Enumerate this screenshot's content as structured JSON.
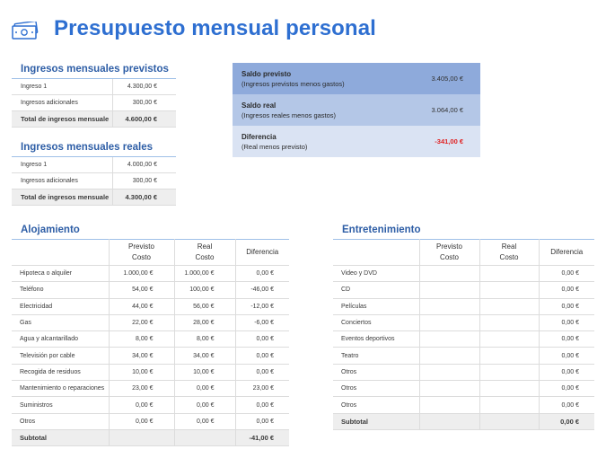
{
  "page": {
    "title": "Presupuesto mensual personal",
    "icon": "money-icon",
    "accent_color": "#2e6fd1"
  },
  "ingresos_previstos": {
    "title": "Ingresos mensuales previstos",
    "rows": [
      {
        "label": "Ingreso 1",
        "value": "4.300,00 €"
      },
      {
        "label": "Ingresos adicionales",
        "value": "300,00 €"
      }
    ],
    "total_label": "Total de ingresos mensuale",
    "total_value": "4.600,00 €"
  },
  "ingresos_reales": {
    "title": "Ingresos mensuales reales",
    "rows": [
      {
        "label": "Ingreso 1",
        "value": "4.000,00 €"
      },
      {
        "label": "Ingresos adicionales",
        "value": "300,00 €"
      }
    ],
    "total_label": "Total de ingresos mensuale",
    "total_value": "4.300,00 €"
  },
  "resumen": {
    "saldo_previsto": {
      "title": "Saldo previsto",
      "subtitle": "(Ingresos previstos menos gastos)",
      "value": "3.405,00 €",
      "bg": "#8eaadb"
    },
    "saldo_real": {
      "title": "Saldo real",
      "subtitle": "(Ingresos reales menos gastos)",
      "value": "3.064,00 €",
      "bg": "#b4c7e7"
    },
    "diferencia": {
      "title": "Diferencia",
      "subtitle": "(Real menos previsto)",
      "value": "-341,00 €",
      "bg": "#dae3f3",
      "value_color": "#e02020"
    }
  },
  "alojamiento": {
    "title": "Alojamiento",
    "headers": {
      "previsto": "Previsto",
      "real": "Real",
      "costo": "Costo",
      "diferencia": "Diferencia"
    },
    "rows": [
      {
        "label": "Hipoteca o alquiler",
        "previsto": "1.000,00 €",
        "real": "1.000,00 €",
        "diferencia": "0,00 €"
      },
      {
        "label": "Teléfono",
        "previsto": "54,00 €",
        "real": "100,00 €",
        "diferencia": "-46,00 €"
      },
      {
        "label": "Electricidad",
        "previsto": "44,00 €",
        "real": "56,00 €",
        "diferencia": "-12,00 €"
      },
      {
        "label": "Gas",
        "previsto": "22,00 €",
        "real": "28,00 €",
        "diferencia": "-6,00 €"
      },
      {
        "label": "Agua y alcantarillado",
        "previsto": "8,00 €",
        "real": "8,00 €",
        "diferencia": "0,00 €"
      },
      {
        "label": "Televisión por cable",
        "previsto": "34,00 €",
        "real": "34,00 €",
        "diferencia": "0,00 €"
      },
      {
        "label": "Recogida de residuos",
        "previsto": "10,00 €",
        "real": "10,00 €",
        "diferencia": "0,00 €"
      },
      {
        "label": "Mantenimiento o reparaciones",
        "previsto": "23,00 €",
        "real": "0,00 €",
        "diferencia": "23,00 €"
      },
      {
        "label": "Suministros",
        "previsto": "0,00 €",
        "real": "0,00 €",
        "diferencia": "0,00 €"
      },
      {
        "label": "Otros",
        "previsto": "0,00 €",
        "real": "0,00 €",
        "diferencia": "0,00 €"
      }
    ],
    "subtotal": {
      "label": "Subtotal",
      "previsto": "",
      "real": "",
      "diferencia": "-41,00 €"
    }
  },
  "entretenimiento": {
    "title": "Entretenimiento",
    "headers": {
      "previsto": "Previsto",
      "real": "Real",
      "costo": "Costo",
      "diferencia": "Diferencia"
    },
    "rows": [
      {
        "label": "Video y DVD",
        "previsto": "",
        "real": "",
        "diferencia": "0,00 €"
      },
      {
        "label": "CD",
        "previsto": "",
        "real": "",
        "diferencia": "0,00 €"
      },
      {
        "label": "Películas",
        "previsto": "",
        "real": "",
        "diferencia": "0,00 €"
      },
      {
        "label": "Conciertos",
        "previsto": "",
        "real": "",
        "diferencia": "0,00 €"
      },
      {
        "label": "Eventos deportivos",
        "previsto": "",
        "real": "",
        "diferencia": "0,00 €"
      },
      {
        "label": "Teatro",
        "previsto": "",
        "real": "",
        "diferencia": "0,00 €"
      },
      {
        "label": "Otros",
        "previsto": "",
        "real": "",
        "diferencia": "0,00 €"
      },
      {
        "label": "Otros",
        "previsto": "",
        "real": "",
        "diferencia": "0,00 €"
      },
      {
        "label": "Otros",
        "previsto": "",
        "real": "",
        "diferencia": "0,00 €"
      }
    ],
    "subtotal": {
      "label": "Subtotal",
      "previsto": "",
      "real": "",
      "diferencia": "0,00 €"
    }
  }
}
